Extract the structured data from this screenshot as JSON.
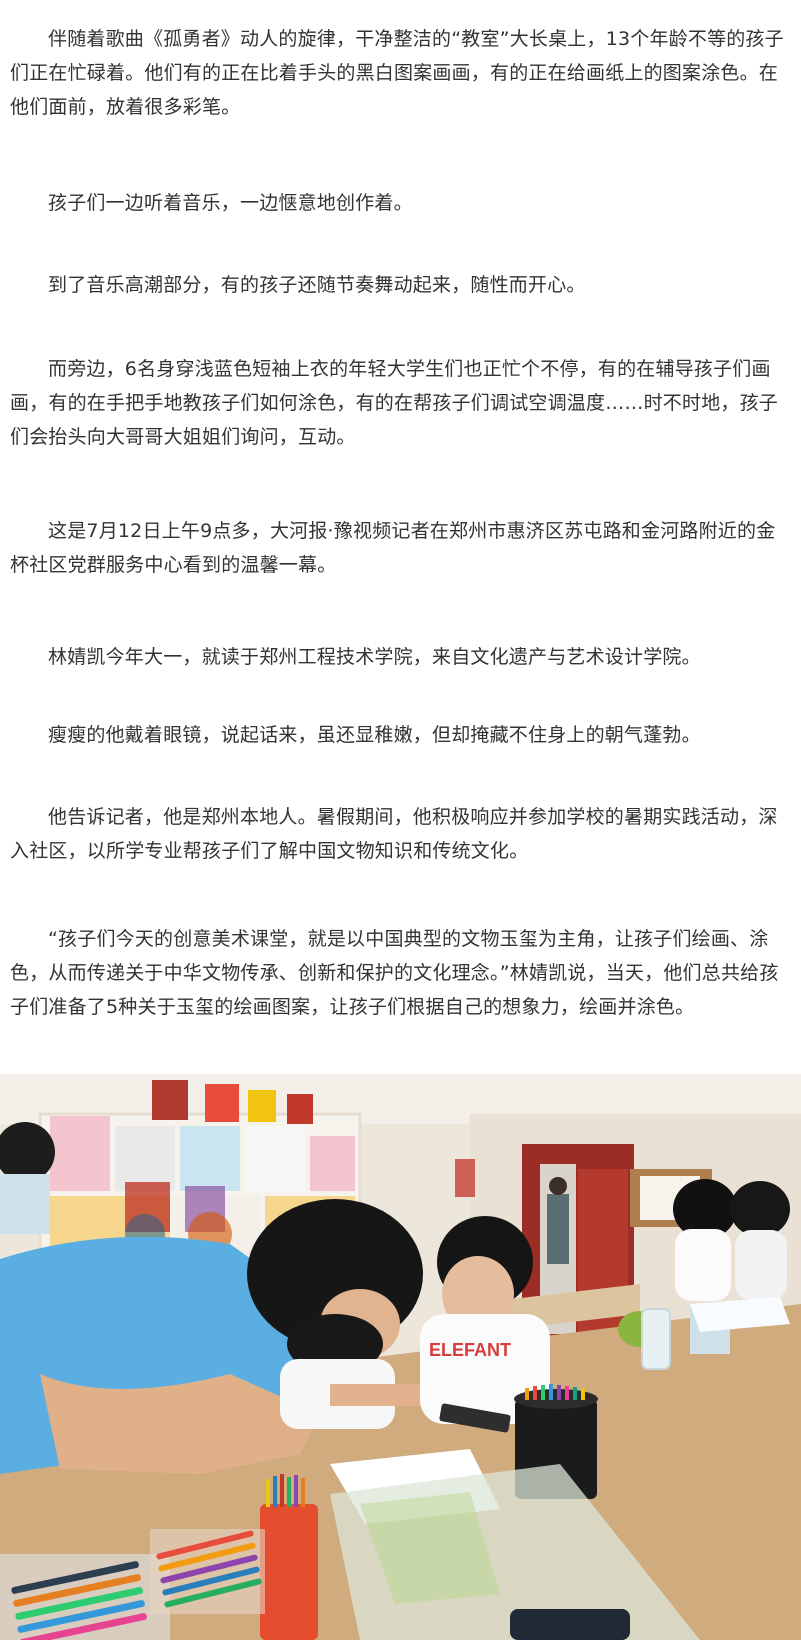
{
  "article": {
    "paragraphs": [
      "伴随着歌曲《孤勇者》动人的旋律，干净整洁的“教室”大长桌上，13个年龄不等的孩子们正在忙碌着。他们有的正在比着手头的黑白图案画画，有的正在给画纸上的图案涂色。在他们面前，放着很多彩笔。",
      "孩子们一边听着音乐，一边惬意地创作着。",
      "到了音乐高潮部分，有的孩子还随节奏舞动起来，随性而开心。",
      "而旁边，6名身穿浅蓝色短袖上衣的年轻大学生们也正忙个不停，有的在辅导孩子们画画，有的在手把手地教孩子们如何涂色，有的在帮孩子们调试空调温度……时不时地，孩子们会抬头向大哥哥大姐姐们询问，互动。",
      "这是7月12日上午9点多，大河报·豫视频记者在郑州市惠济区苏屯路和金河路附近的金杯社区党群服务中心看到的温馨一幕。",
      "林婧凯今年大一，就读于郑州工程技术学院，来自文化遗产与艺术设计学院。",
      "瘦瘦的他戴着眼镜，说起话来，虽还显稚嫩，但却掩藏不住身上的朝气蓬勃。",
      "他告诉记者，他是郑州本地人。暑假期间，他积极响应并参加学校的暑期实践活动，深入社区，以所学专业帮孩子们了解中国文物知识和传统文化。",
      "“孩子们今天的创意美术课堂，就是以中国典型的文物玉玺为主角，让孩子们绘画、涂色，从而传递关于中华文物传承、创新和保护的文化理念。”林婧凯说，当天，他们总共给孩子们准备了5种关于玉玺的绘画图案，让孩子们根据自己的想象力，绘画并涂色。"
    ],
    "photo": {
      "shirt_print": "ELEFANT"
    }
  }
}
